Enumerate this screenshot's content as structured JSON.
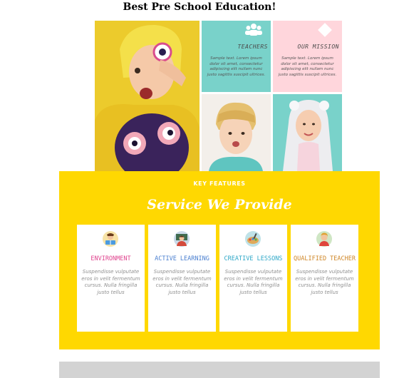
{
  "page": {
    "title": "Best Pre School Education!"
  },
  "hero": {
    "teachers": {
      "heading": "TEACHERS",
      "text": "Sample text. Lorem ipsum dolor sit amet, consectetur adipiscing elit nullam nunc justo sagittis suscipit ultrices.",
      "icon": "users-icon"
    },
    "mission": {
      "heading": "OUR MISSION",
      "text": "Sample text. Lorem ipsum dolor sit amet, consectetur adipiscing elit nullam nunc justo sagittis suscipit ultrices.",
      "icon": "diamond-icon"
    }
  },
  "features": {
    "kicker": "KEY FEATURES",
    "title": "Service We Provide",
    "cards": [
      {
        "title": "ENVIRONMENT",
        "color": "#e0458f",
        "text": "Suspendisse vulputate eros in velit fermentum cursus. Nulla fringilla justo tellus",
        "icon": "child-reading-icon"
      },
      {
        "title": "ACTIVE LEARNING",
        "color": "#4a7fd0",
        "text": "Suspendisse vulputate eros in velit fermentum cursus. Nulla fringilla justo tellus",
        "icon": "teacher-blackboard-icon"
      },
      {
        "title": "CREATIVE LESSONS",
        "color": "#2fa8c8",
        "text": "Suspendisse vulputate eros in velit fermentum cursus. Nulla fringilla justo tellus",
        "icon": "art-supplies-icon"
      },
      {
        "title": "QUALIFIED TEACHER",
        "color": "#d0882a",
        "text": "Suspendisse vulputate eros in velit fermentum cursus. Nulla fringilla justo tellus",
        "icon": "teacher-icon"
      }
    ]
  },
  "colors": {
    "features_bg": "#ffd801",
    "teal": "#79d2ca",
    "pink": "#ffd6dc",
    "footer": "#d3d3d3"
  }
}
